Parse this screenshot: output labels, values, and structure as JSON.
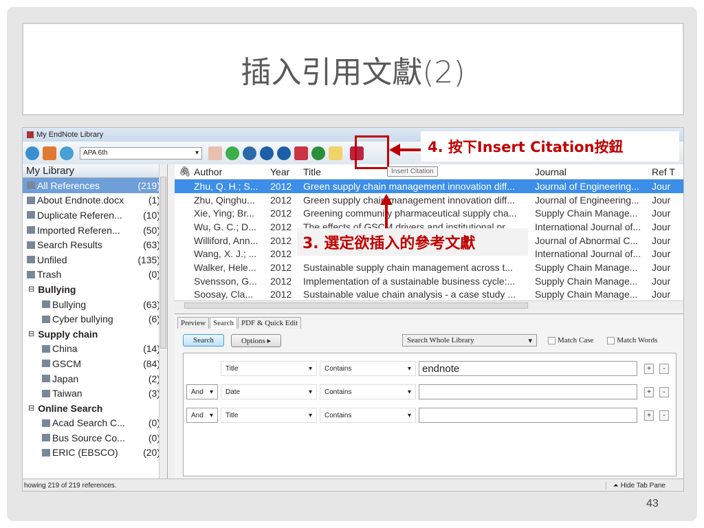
{
  "slide": {
    "title": "插入引用文獻(2)",
    "page_number": "43"
  },
  "window": {
    "title": "My EndNote Library",
    "style": "APA 6th"
  },
  "sidebar": {
    "header": "My Library",
    "items": [
      {
        "label": "All References",
        "count": "(219)",
        "type": "item",
        "selected": true
      },
      {
        "label": "About Endnote.docx",
        "count": "(1)",
        "type": "item"
      },
      {
        "label": "Duplicate Referen...",
        "count": "(10)",
        "type": "item"
      },
      {
        "label": "Imported Referen...",
        "count": "(50)",
        "type": "item"
      },
      {
        "label": "Search Results",
        "count": "(63)",
        "type": "item"
      },
      {
        "label": "Unfiled",
        "count": "(135)",
        "type": "item"
      },
      {
        "label": "Trash",
        "count": "(0)",
        "type": "item"
      },
      {
        "label": "Bullying",
        "count": "",
        "type": "group"
      },
      {
        "label": "Bullying",
        "count": "(63)",
        "type": "sub"
      },
      {
        "label": "Cyber bullying",
        "count": "(6)",
        "type": "sub"
      },
      {
        "label": "Supply chain",
        "count": "",
        "type": "group"
      },
      {
        "label": "China",
        "count": "(14)",
        "type": "sub"
      },
      {
        "label": "GSCM",
        "count": "(84)",
        "type": "sub"
      },
      {
        "label": "Japan",
        "count": "(2)",
        "type": "sub"
      },
      {
        "label": "Taiwan",
        "count": "(3)",
        "type": "sub"
      },
      {
        "label": "Online Search",
        "count": "",
        "type": "group"
      },
      {
        "label": "Acad Search C...",
        "count": "(0)",
        "type": "sub"
      },
      {
        "label": "Bus Source Co...",
        "count": "(0)",
        "type": "sub"
      },
      {
        "label": "ERIC (EBSCO)",
        "count": "(20)",
        "type": "sub"
      }
    ]
  },
  "list": {
    "columns": [
      "Author",
      "Year",
      "Title",
      "Journal",
      "Ref T"
    ],
    "rows": [
      [
        "Zhu, Q. H.; S...",
        "2012",
        "Green supply chain management innovation diff...",
        "Journal of Engineering...",
        "Jour"
      ],
      [
        "Zhu, Qinghu...",
        "2012",
        "Green supply chain management innovation diff...",
        "Journal of Engineering...",
        "Jour"
      ],
      [
        "Xie, Ying; Br...",
        "2012",
        "Greening community pharmaceutical supply cha...",
        "Supply Chain Manage...",
        "Jour"
      ],
      [
        "Wu, G. C.; D...",
        "2012",
        "The effects of GSCM drivers and institutional pr...",
        "International Journal of...",
        "Jour"
      ],
      [
        "Williford, Ann...",
        "2012",
        "",
        "Journal of Abnormal C...",
        "Jour"
      ],
      [
        "Wang, X. J.; ...",
        "2012",
        "",
        "International Journal of...",
        "Jour"
      ],
      [
        "Walker, Hele...",
        "2012",
        "Sustainable supply chain management across t...",
        "Supply Chain Manage...",
        "Jour"
      ],
      [
        "Svensson, G...",
        "2012",
        "Implementation of a sustainable business cycle:...",
        "Supply Chain Manage...",
        "Jour"
      ],
      [
        "Soosay, Cla...",
        "2012",
        "Sustainable value chain analysis - a case study ...",
        "Supply Chain Manage...",
        "Jour"
      ]
    ]
  },
  "tooltip": "Insert Citation",
  "search_pane": {
    "tabs": [
      "Preview",
      "Search",
      "PDF & Quick Edit"
    ],
    "search_button": "Search",
    "options_button": "Options ▸",
    "scope": "Search Whole Library",
    "match_case": "Match Case",
    "match_words": "Match Words",
    "criteria": [
      {
        "op": "",
        "field": "Title",
        "cond": "Contains",
        "value": "endnote"
      },
      {
        "op": "And",
        "field": "Date",
        "cond": "Contains",
        "value": ""
      },
      {
        "op": "And",
        "field": "Title",
        "cond": "Contains",
        "value": ""
      }
    ]
  },
  "status": {
    "left": "howing 219 of 219 references.",
    "right": "Hide Tab Pane"
  },
  "callouts": {
    "step4": "4. 按下Insert Citation按鈕",
    "step3": "3. 選定欲插入的參考文獻"
  },
  "colors": {
    "accent": "#c00000",
    "selection": "#3c8ee8"
  }
}
